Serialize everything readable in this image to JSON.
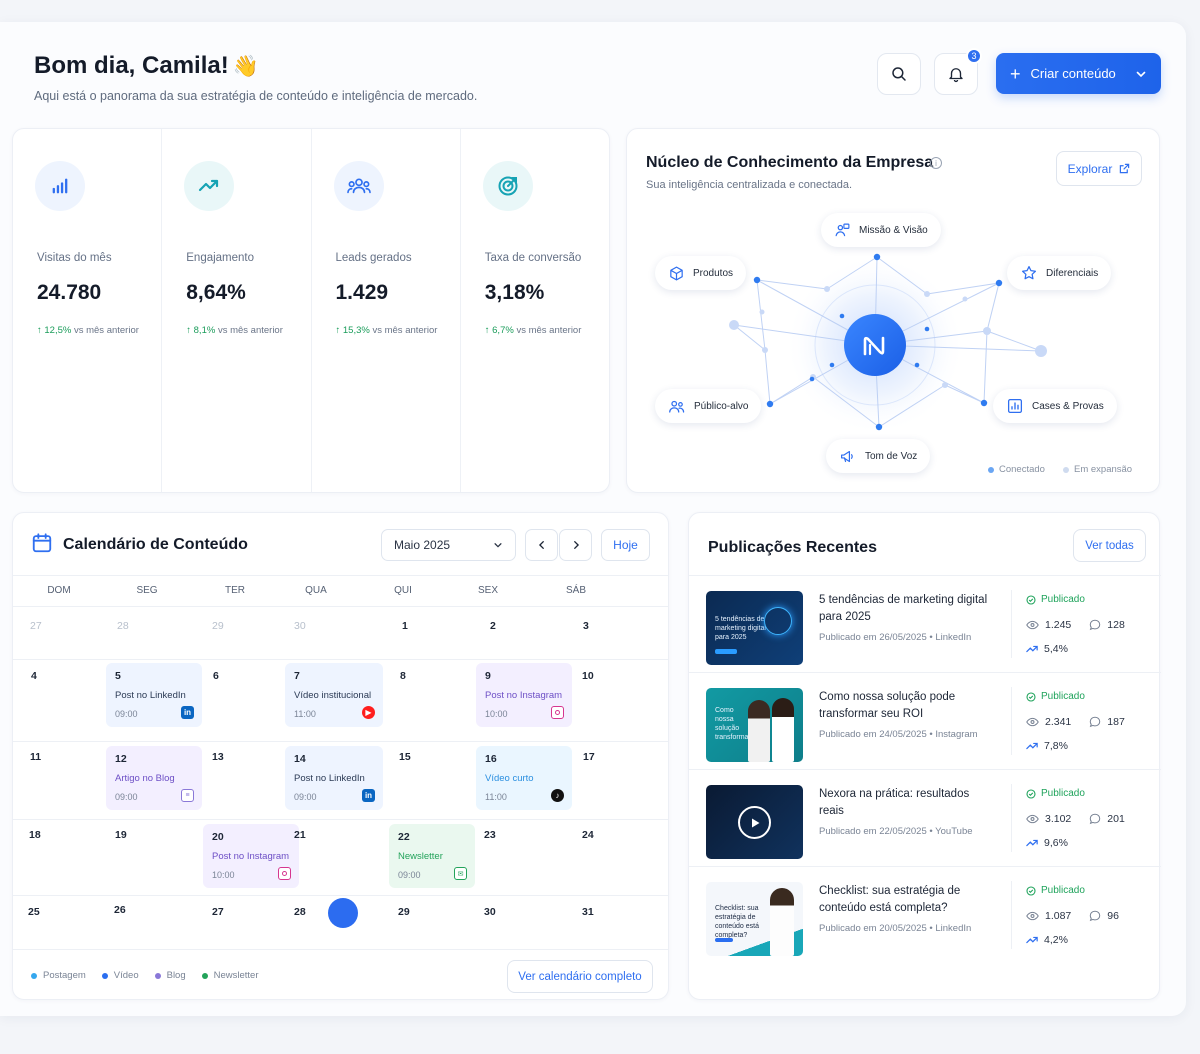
{
  "header": {
    "greeting": "Bom dia, Camila!",
    "greeting_emoji": "👋",
    "subtitle": "Aqui está o panorama da sua estratégia de conteúdo e inteligência de mercado.",
    "notification_count": "3",
    "create_button": "Criar conteúdo"
  },
  "metrics": [
    {
      "icon": "bar-chart-icon",
      "label": "Visitas do mês",
      "value": "24.780",
      "change": "12,5%",
      "change_suffix": "vs mês anterior"
    },
    {
      "icon": "trending-up-icon",
      "label": "Engajamento",
      "value": "8,64%",
      "change": "8,1%",
      "change_suffix": "vs mês anterior"
    },
    {
      "icon": "users-icon",
      "label": "Leads gerados",
      "value": "1.429",
      "change": "15,3%",
      "change_suffix": "vs mês anterior"
    },
    {
      "icon": "target-icon",
      "label": "Taxa de conversão",
      "value": "3,18%",
      "change": "6,7%",
      "change_suffix": "vs mês anterior"
    }
  ],
  "knowledge": {
    "title": "Núcleo de Conhecimento da Empresa",
    "subtitle": "Sua inteligência centralizada e conectada.",
    "explore_button": "Explorar",
    "center_logo": "N",
    "nodes": {
      "mission": "Missão & Visão",
      "products": "Produtos",
      "differentials": "Diferenciais",
      "audience": "Público-alvo",
      "cases": "Cases & Provas",
      "tone": "Tom de Voz"
    },
    "legend": {
      "connected": "Conectado",
      "expanding": "Em expansão"
    }
  },
  "calendar": {
    "title": "Calendário de Conteúdo",
    "month": "Maio 2025",
    "today_button": "Hoje",
    "weekdays": [
      "DOM",
      "SEG",
      "TER",
      "QUA",
      "QUI",
      "SEX",
      "SÁB"
    ],
    "weeks": [
      [
        "27",
        "28",
        "29",
        "30",
        "1",
        "2",
        "3"
      ],
      [
        "4",
        "5",
        "6",
        "7",
        "8",
        "9",
        "10"
      ],
      [
        "11",
        "12",
        "13",
        "14",
        "15",
        "16",
        "17"
      ],
      [
        "18",
        "19",
        "20",
        "21",
        "22",
        "23",
        "24"
      ],
      [
        "25",
        "26",
        "27",
        "28",
        "29",
        "30",
        "31"
      ]
    ],
    "events": [
      {
        "day": "5",
        "title": "Post no LinkedIn",
        "time": "09:00",
        "channel": "LinkedIn",
        "color": "#0a66c2"
      },
      {
        "day": "7",
        "title": "Vídeo institucional",
        "time": "11:00",
        "channel": "YouTube",
        "color": "#ff1e1e"
      },
      {
        "day": "9",
        "title": "Post no Instagram",
        "time": "10:00",
        "channel": "Instagram",
        "color": "#d6368f"
      },
      {
        "day": "12",
        "title": "Artigo no Blog",
        "time": "09:00",
        "channel": "Blog",
        "color": "#8a78d8"
      },
      {
        "day": "14",
        "title": "Post no LinkedIn",
        "time": "09:00",
        "channel": "LinkedIn",
        "color": "#0a66c2"
      },
      {
        "day": "16",
        "title": "Vídeo curto",
        "time": "11:00",
        "channel": "TikTok",
        "color": "#111111"
      },
      {
        "day": "20",
        "title": "Post no Instagram",
        "time": "10:00",
        "channel": "Instagram",
        "color": "#d6368f"
      },
      {
        "day": "22",
        "title": "Newsletter",
        "time": "09:00",
        "channel": "Email",
        "color": "#23a35a"
      }
    ],
    "legend": [
      {
        "label": "Postagem",
        "color": "#35a7ee"
      },
      {
        "label": "Vídeo",
        "color": "#2a6ef0"
      },
      {
        "label": "Blog",
        "color": "#8a78d8"
      },
      {
        "label": "Newsletter",
        "color": "#23a35a"
      }
    ],
    "full_calendar_button": "Ver calendário completo"
  },
  "recent": {
    "title": "Publicações Recentes",
    "see_all_button": "Ver todas",
    "items": [
      {
        "title": "5 tendências de marketing digital para 2025",
        "meta": "Publicado em 26/05/2025 • LinkedIn",
        "status": "Publicado",
        "views": "1.245",
        "comments": "128",
        "rate": "5,4%",
        "thumb_text": "5 tendências de marketing digital para 2025"
      },
      {
        "title": "Como nossa solução pode transformar seu ROI",
        "meta": "Publicado em 24/05/2025 • Instagram",
        "status": "Publicado",
        "views": "2.341",
        "comments": "187",
        "rate": "7,8%",
        "thumb_text": "Como nossa solução transforma"
      },
      {
        "title": "Nexora na prática: resultados reais",
        "meta": "Publicado em 22/05/2025 • YouTube",
        "status": "Publicado",
        "views": "3.102",
        "comments": "201",
        "rate": "9,6%",
        "thumb_text": ""
      },
      {
        "title": "Checklist: sua estratégia de conteúdo está completa?",
        "meta": "Publicado em 20/05/2025 • LinkedIn",
        "status": "Publicado",
        "views": "1.087",
        "comments": "96",
        "rate": "4,2%",
        "thumb_text": "Checklist: sua estratégia de conteúdo está completa?"
      }
    ]
  }
}
